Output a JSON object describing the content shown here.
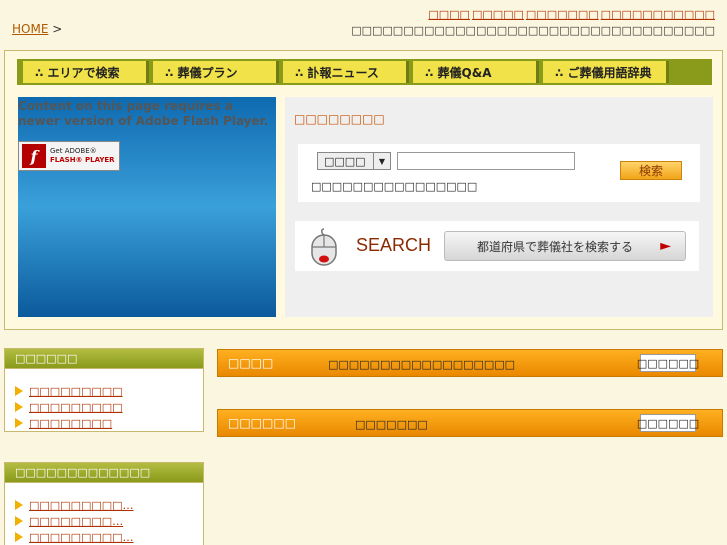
{
  "breadcrumb": {
    "home": "HOME",
    "sep": ">"
  },
  "top_links": [
    "□□□□",
    "□□□□□",
    "□□□□□□□",
    "□□□□□□□□□□□"
  ],
  "tagline": "□□□□□□□□□□□□□□□□□□□□□□□□□□□□□□□□□□□",
  "nav": [
    "∴ エリアで検索",
    "∴ 葬儀プラン",
    "∴ 訃報ニュース",
    "∴ 葬儀Q&A",
    "∴ ご葬儀用語辞典"
  ],
  "flash": {
    "message": "Content on this page requires a newer version of Adobe Flash Player.",
    "get_line1": "Get ADOBE®",
    "get_line2": "FLASH® PLAYER",
    "logo": "f"
  },
  "search": {
    "title": "□□□□□□□□",
    "select_value": "□□□□",
    "input_value": "",
    "button": "検索",
    "hint": "□□□□□□□□□□□□□□□□",
    "word": "SEARCH",
    "pref_button": "都道府県で葬儀社を検索する",
    "pref_arrow": "►"
  },
  "sidebar": [
    {
      "title": "□□□□□□",
      "items": [
        "□□□□□□□□□",
        "□□□□□□□□□",
        "□□□□□□□□"
      ]
    },
    {
      "title": "□□□□□□□□□□□□□",
      "items": [
        "□□□□□□□□□…",
        "□□□□□□□□…",
        "□□□□□□□□□…"
      ]
    }
  ],
  "bars": [
    {
      "title": "□□□□",
      "text": "□□□□□□□□□□□□□□□□□□",
      "button": "□□□□□□"
    },
    {
      "title": "□□□□□□",
      "text": "□□□□□□□",
      "button": "□□□□□□"
    }
  ],
  "colors": {
    "nav_bg": "#8a9a1a",
    "nav_item": "#f2e24a",
    "orange": "#e98800",
    "link": "#b03000",
    "flash_blue": "#0f6ab0"
  }
}
